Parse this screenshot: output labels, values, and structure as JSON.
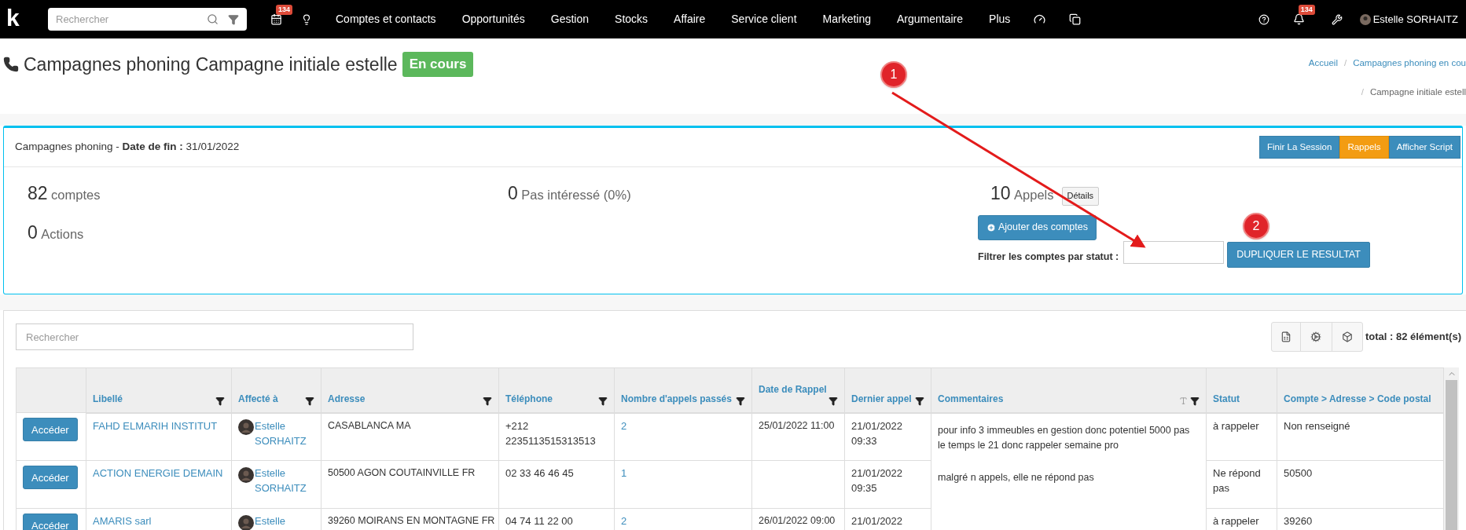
{
  "topbar": {
    "logo": "k",
    "search": {
      "placeholder": "Rechercher"
    },
    "calendar_badge": "134",
    "nav": [
      "Comptes et contacts",
      "Opportunités",
      "Gestion",
      "Stocks",
      "Affaire",
      "Service client",
      "Marketing",
      "Argumentaire",
      "Plus"
    ],
    "notifications_badge": "134",
    "user": "Estelle SORHAITZ"
  },
  "page_header": {
    "title": "Campagnes phoning Campagne initiale estelle",
    "status": "En cours",
    "breadcrumb": [
      [
        {
          "kind": "link",
          "text": "Accueil"
        },
        {
          "kind": "separator",
          "text": "/"
        },
        {
          "kind": "link",
          "text": "Campagnes phoning en cou"
        }
      ],
      [
        {
          "kind": "separator",
          "text": "/"
        },
        {
          "kind": "current",
          "text": "Campagne initiale estell"
        }
      ]
    ]
  },
  "campaign_card": {
    "title": "Campagnes phoning - **Date de fin :** 31/01/2022",
    "buttons": [
      {
        "label": "Finir La Session",
        "kind": "primary"
      },
      {
        "label": "Rappels",
        "kind": "warning"
      },
      {
        "label": "Afficher Script",
        "kind": "primary"
      }
    ],
    "stats_columns": [
      [
        {
          "value": "82",
          "label": "comptes"
        },
        {
          "value": "0",
          "label": "Actions"
        }
      ],
      [
        {
          "value": "0",
          "label": "Pas intéressé (0%)"
        }
      ],
      [
        {
          "value": "10",
          "label": "Appels",
          "button": "Détails"
        }
      ]
    ],
    "add_button": "Ajouter des comptes",
    "filter": {
      "label": "Filtrer les comptes par statut :"
    },
    "duplicate_button": "DUPLIQUER LE RESULTAT"
  },
  "table_section": {
    "search": {
      "placeholder": "Rechercher"
    },
    "total": "total : 82 élément(s)",
    "columns": [
      {
        "label": "Libellé",
        "filter": true
      },
      {
        "label": "Affecté à",
        "filter": true
      },
      {
        "label": "Adresse",
        "filter": true
      },
      {
        "label": "Téléphone",
        "filter": true
      },
      {
        "label": "Nombre d'appels passés",
        "filter": true
      },
      {
        "label": "Date de Rappel",
        "filter": true
      },
      {
        "label": "Dernier appel",
        "filter": true
      },
      {
        "label": "Commentaires",
        "filter": true,
        "text_size": true
      },
      {
        "label": "Statut",
        "filter": false
      },
      {
        "label": "Compte > Adresse > Code postal",
        "filter": false
      }
    ],
    "rows": [
      {
        "button": "Accéder",
        "libelle": "FAHD ELMARIH INSTITUT",
        "affecte": "Estelle SORHAITZ",
        "adresse": "CASABLANCA MA",
        "telephone": "+212 2235113515313513",
        "appels": "2",
        "date_rappel": "25/01/2022 11:00",
        "dernier_appel": "21/01/2022 09:33",
        "commentaire": "pour info 3 immeubles en gestion donc potentiel 5000 pas le temps le 21 donc rappeler semaine pro",
        "statut": "à rappeler",
        "code_postal": "Non renseigné"
      },
      {
        "button": "Accéder",
        "libelle": "ACTION ENERGIE DEMAIN",
        "affecte": "Estelle SORHAITZ",
        "adresse": "50500 AGON COUTAINVILLE FR",
        "telephone": "02 33 46 46 45",
        "appels": "1",
        "dernier_appel": "21/01/2022 09:35",
        "commentaire": "malgré n appels, elle ne répond pas",
        "statut": "Ne répond pas",
        "code_postal": "50500"
      },
      {
        "button": "Accéder",
        "libelle": "AMARIS sarl",
        "affecte": "Estelle",
        "adresse": "39260 MOIRANS EN MONTAGNE FR",
        "telephone": "04 74 11 22 00",
        "appels": "2",
        "date_rappel": "26/01/2022 09:00",
        "dernier_appel": "21/01/2022",
        "statut": "à rappeler",
        "code_postal": "39260"
      }
    ]
  },
  "annotations": [
    {
      "label": "1"
    },
    {
      "label": "2"
    }
  ]
}
